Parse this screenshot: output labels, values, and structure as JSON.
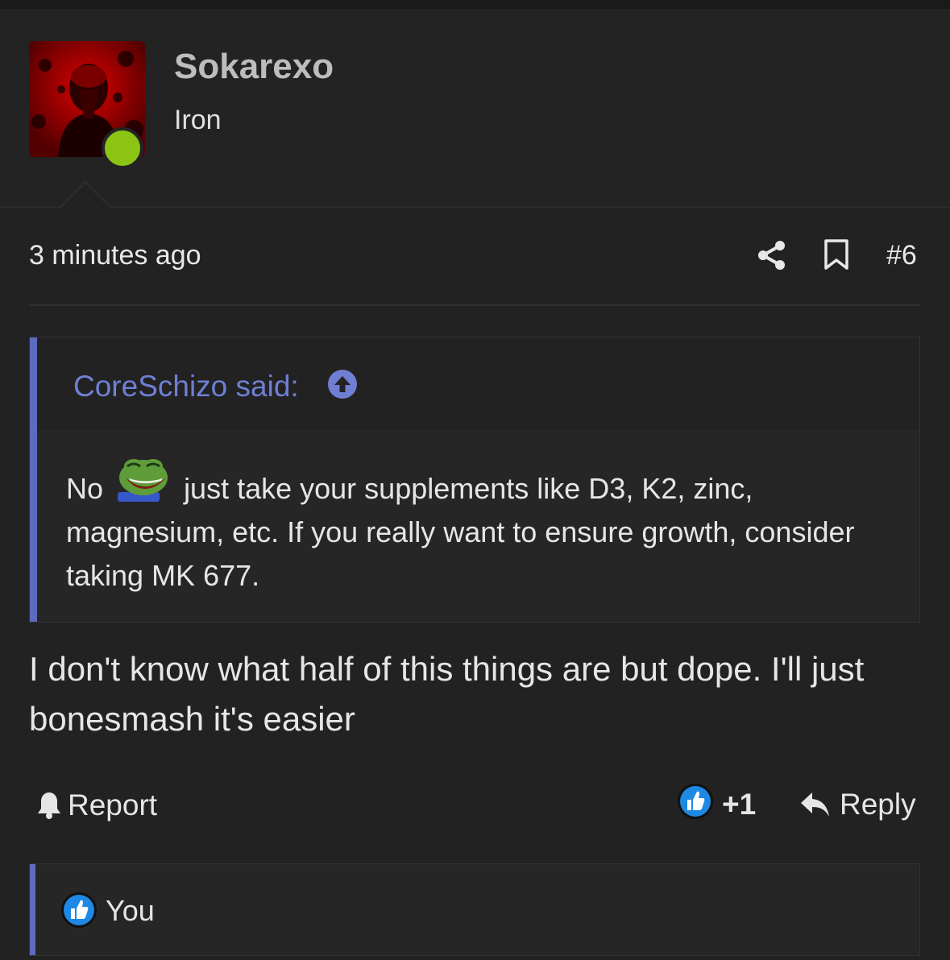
{
  "user": {
    "name": "Sokarexo",
    "title": "Iron"
  },
  "post": {
    "timestamp": "3 minutes ago",
    "number": "#6",
    "text": "I don't know what half of this things are but dope. I'll just bonesmash it's easier"
  },
  "quote": {
    "author": "CoreSchizo said:",
    "text_before": "No",
    "text_after": "just take your supplements like D3, K2, zinc, magnesium, etc. If you really want to ensure growth, consider taking MK 677."
  },
  "actions": {
    "report": "Report",
    "like_count": "+1",
    "reply": "Reply"
  },
  "reactions": {
    "names": "You"
  },
  "colors": {
    "accent": "#5c6bc0",
    "link": "#6f7fd4",
    "online": "#8cc414",
    "like": "#1e88e5"
  }
}
